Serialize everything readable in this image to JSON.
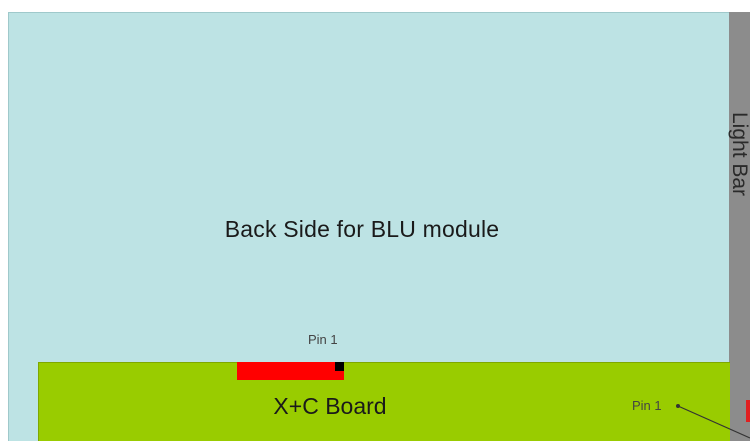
{
  "diagram": {
    "module_label": "Back Side for BLU module",
    "light_bar_label": "Light Bar",
    "board_label": "X+C Board",
    "pin_top_label": "Pin 1",
    "pin_right_label": "Pin 1",
    "colors": {
      "module": "#bde3e4",
      "light_bar": "#8c8c8c",
      "board": "#99cc00",
      "connector": "#ff0000",
      "pin_marker": "#000000"
    }
  }
}
